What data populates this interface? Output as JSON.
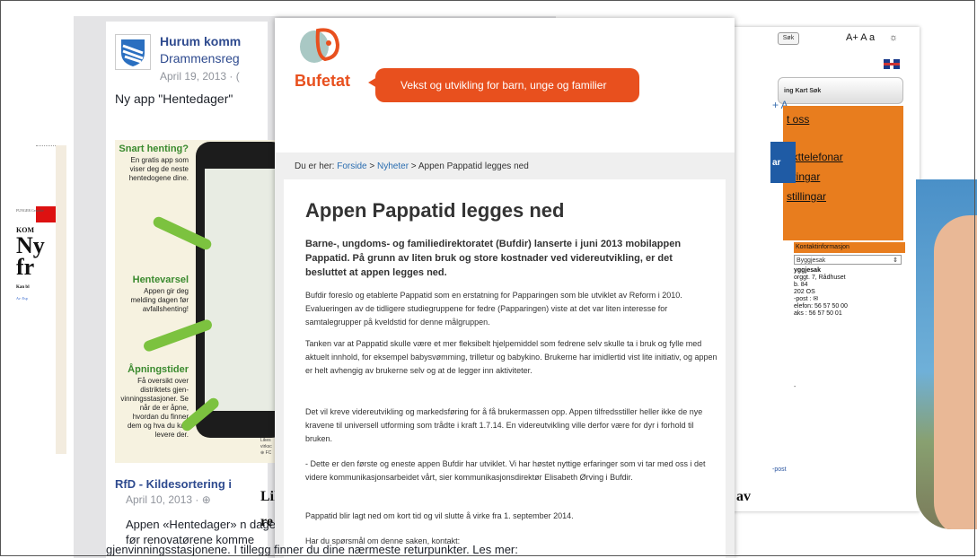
{
  "news": {
    "tiny": "FUNGER\nCeiuribe",
    "kom": "KOM",
    "head1": "Ny",
    "head2": "fr",
    "kan": "Kan bl",
    "av": "Av: Esp"
  },
  "facebook": {
    "page_name": "Hurum komm",
    "page_name2": "Drammensreg",
    "date": "April 19, 2013 · (",
    "post": "Ny app \"Hentedager\"",
    "ad": {
      "h1": "Snart henting?",
      "t1": "En gratis app som viser deg de neste hentedogene dine.",
      "h2": "Hentevarsel",
      "t2": "Appen gir deg melding dagen før avfallshenting!",
      "h3": "Åpningstider",
      "t3": "Få oversikt over distriktets gjen-vinningsstasjoner. Se når de er åpne, hvordan du finner dem og hva du kan levere der."
    },
    "post2_title": "RfD - Kildesortering i",
    "post2_date": "April 10, 2013 · ⊕",
    "post2_text": "Appen «Hentedager» n dagen før renovatørene komme",
    "tail_text": "gjenvinningsstasjonene. I tillegg finner du dine nærmeste returpunkter. Les mer:"
  },
  "under": {
    "liker": "Likes\nvirksc\n⊕ FC",
    "big1": "Lil",
    "big2": "re",
    "av": "av"
  },
  "municipality": {
    "search_button": "Søk",
    "font_size": "A+ A a",
    "sun": "☼",
    "nav": "ing  Kart  Søk",
    "plus_a": "+ A",
    "links": [
      "t oss",
      "akttelefonar",
      "eringar",
      "stillingar"
    ],
    "blue_text": "ar",
    "contact_header": "Kontaktinformasjon",
    "select_value": "Byggjesak",
    "addr_title": "yggjesak",
    "addr_lines": [
      "orggt. 7, Rådhuset",
      "b. 84",
      "202 OS",
      "-post : ✉",
      "elefon: 56 57 50 00",
      "aks   : 56 57 50 01"
    ],
    "dash": "-",
    "epost": "-post"
  },
  "bufetat": {
    "brand": "Bufetat",
    "tagline": "Vekst og utvikling for barn, unge og familier",
    "crumb_prefix": "Du er her:",
    "crumb_home": "Forside",
    "crumb_news": "Nyheter",
    "crumb_current": "Appen Pappatid legges ned",
    "title": "Appen Pappatid legges ned",
    "lead": "Barne-, ungdoms- og familiedirektoratet (Bufdir) lanserte i juni 2013 mobilappen Pappatid. På grunn av liten bruk og store kostnader ved videreutvikling, er det besluttet at appen legges ned.",
    "paragraphs": [
      "Bufdir foreslo og etablerte Pappatid som en erstatning for Papparingen som ble utviklet av Reform i 2010. Evalueringen av de tidligere studiegruppene for fedre (Papparingen) viste at det var liten interesse for samtalegrupper på kveldstid for denne målgruppen.",
      "Tanken var at Pappatid skulle være et mer fleksibelt hjelpemiddel som fedrene selv skulle ta i bruk og fylle med aktuelt innhold, for eksempel babysvømming, trilletur og babykino. Brukerne har imidlertid vist lite initiativ, og appen er helt avhengig av brukerne selv og at de legger inn aktiviteter.",
      "Det vil kreve videreutvikling og markedsføring for å få brukermassen opp. Appen tilfredsstiller heller ikke de nye kravene til universell utforming som trådte i kraft 1.7.14. En videreutvikling ville derfor være for dyr i forhold til bruken.",
      "- Dette er den første og eneste appen Bufdir har utviklet. Vi har høstet nyttige erfaringer som vi tar med oss i det videre kommunikasjonsarbeidet vårt, sier kommunikasjonsdirektør Elisabeth Ørving i Bufdir.",
      "Pappatid blir lagt ned om kort tid og vil slutte å virke fra 1. september 2014.",
      "Har du spørsmål om denne saken, kontakt:"
    ]
  },
  "colors": {
    "bufetat_orange": "#e8501e",
    "fb_blue": "#2f4b8f",
    "muni_orange": "#e87d1e"
  }
}
